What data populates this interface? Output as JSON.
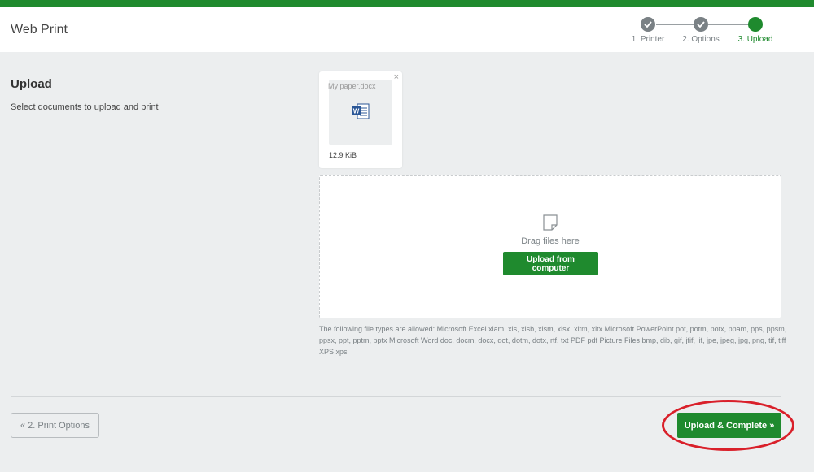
{
  "app": {
    "title": "Web Print"
  },
  "steps": [
    {
      "label": "1. Printer",
      "state": "done"
    },
    {
      "label": "2. Options",
      "state": "done"
    },
    {
      "label": "3. Upload",
      "state": "active"
    }
  ],
  "section": {
    "title": "Upload",
    "description": "Select documents to upload and print"
  },
  "file": {
    "name": "My paper.docx",
    "size": "12.9 KiB",
    "remove_label": "×",
    "icon": "word-document-icon"
  },
  "dropzone": {
    "drop_text": "Drag files here",
    "upload_button": "Upload from computer",
    "icon": "document-icon"
  },
  "allowed_types": "The following file types are allowed: Microsoft Excel xlam, xls, xlsb, xlsm, xlsx, xltm, xltx Microsoft PowerPoint pot, potm, potx, ppam, pps, ppsm, ppsx, ppt, pptm, pptx Microsoft Word doc, docm, docx, dot, dotm, dotx, rtf, txt PDF pdf Picture Files bmp, dib, gif, jfif, jif, jpe, jpeg, jpg, png, tif, tiff XPS xps",
  "footer": {
    "back_button": "« 2. Print Options",
    "complete_button": "Upload & Complete »"
  },
  "colors": {
    "accent": "#1f8a2e",
    "highlight": "#d9202a",
    "background": "#eceeef"
  }
}
